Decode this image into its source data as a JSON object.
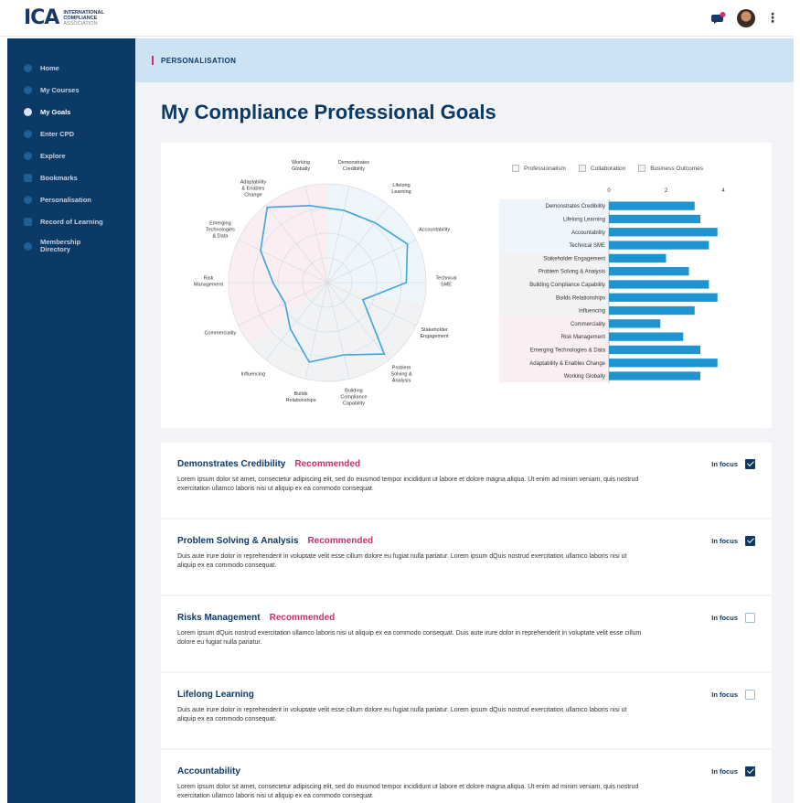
{
  "brand": {
    "mark": "ICA",
    "line1": "INTERNATIONAL",
    "line2": "COMPLIANCE",
    "line3": "ASSOCIATION"
  },
  "sidebar": {
    "items": [
      {
        "label": "Home",
        "icon": "home-icon"
      },
      {
        "label": "My Courses",
        "icon": "courses-icon"
      },
      {
        "label": "My Goals",
        "icon": "goals-icon",
        "active": true
      },
      {
        "label": "Enter CPD",
        "icon": "cpd-icon"
      },
      {
        "label": "Explore",
        "icon": "explore-icon"
      },
      {
        "label": "Bookmarks",
        "icon": "bookmark-icon"
      },
      {
        "label": "Personalisation",
        "icon": "personalisation-icon"
      },
      {
        "label": "Record of Learning",
        "icon": "record-icon"
      },
      {
        "label": "Membership Directory",
        "icon": "directory-icon"
      }
    ]
  },
  "breadcrumb": "PERSONALISATION",
  "page_title": "My Compliance Professional Goals",
  "chart_data": [
    {
      "type": "radar",
      "axes": [
        "Demonstrates Credibility",
        "Lifelong Learning",
        "Accountability",
        "Technical SME",
        "Stakeholder Engagement",
        "Problem Solving & Analysis",
        "Building Compliance Capability",
        "Builds Relationships",
        "Influencing",
        "Commerciality",
        "Risk Management",
        "Emerging Technologies & Data",
        "Adaptability & Enables Change",
        "Working Globally"
      ],
      "values": [
        3,
        3.1,
        3.6,
        3.2,
        1.6,
        3.7,
        3.0,
        3.3,
        2.4,
        1.9,
        2.2,
        3.0,
        3.9,
        3.2
      ],
      "rmax": 4
    },
    {
      "type": "bar",
      "orientation": "horizontal",
      "categories": [
        "Demonstrates Credibility",
        "Lifelong Learning",
        "Accountability",
        "Technical SME",
        "Stakeholder Engagement",
        "Problem Solving & Analysis",
        "Building Compliance Capability",
        "Builds Relationships",
        "Influencing",
        "Commerciality",
        "Risk Management",
        "Emerging Technologies & Data",
        "Adaptability & Enables Change",
        "Working Globally"
      ],
      "values": [
        3.0,
        3.2,
        3.8,
        3.5,
        2.0,
        2.8,
        3.5,
        3.8,
        3.0,
        1.8,
        2.6,
        3.2,
        3.8,
        3.2
      ],
      "groups": [
        "Professionalism",
        "Professionalism",
        "Professionalism",
        "Professionalism",
        "Collaboration",
        "Collaboration",
        "Collaboration",
        "Collaboration",
        "Collaboration",
        "Business Outcomes",
        "Business Outcomes",
        "Business Outcomes",
        "Business Outcomes",
        "Business Outcomes"
      ],
      "xlim": [
        0,
        4
      ],
      "xticks": [
        "0",
        "2",
        "4"
      ]
    }
  ],
  "legend": [
    {
      "label": "Professionalism",
      "color": "#eef5fb"
    },
    {
      "label": "Collaboration",
      "color": "#f1f2f4"
    },
    {
      "label": "Business Outcomes",
      "color": "#fbeef3"
    }
  ],
  "bar_color": "#1e95d0",
  "radar_line_color": "#3aa6dd",
  "accent": "#c8306e",
  "focus_label": "In focus",
  "goals": [
    {
      "title": "Demonstrates Credibility",
      "recommended": "Recommended",
      "desc": "Lorem ipsum dolor sit amet, consectetur adipiscing elit, sed do eiusmod tempor incididunt ut labore et dolore magna aliqua. Ut enim ad minim veniam, quis nostrud exercitation ullamco laboris nisi ut aliquip ex ea commodo consequat.",
      "in_focus": true
    },
    {
      "title": "Problem Solving & Analysis",
      "recommended": "Recommended",
      "desc": "Duis aute irure dolor in reprehenderit in voluptate velit esse cillum dolore eu fugiat nulla pariatur. Lorem ipsum dQuis nostrud exercitation ullamco laboris nisi ut aliquip ex ea commodo consequat.",
      "in_focus": true
    },
    {
      "title": "Risks Management",
      "recommended": "Recommended",
      "desc": "Lorem ipsum dQuis nostrud exercitation ullamco laboris nisi ut aliquip ex ea commodo consequat. Duis aute irure dolor in reprehenderit in voluptate velit esse cillum dolore eu fugiat nulla pariatur.",
      "in_focus": false
    },
    {
      "title": "Lifelong Learning",
      "recommended": "",
      "desc": "Duis aute irure dolor in reprehenderit in voluptate velit esse cillum dolore eu fugiat nulla pariatur. Lorem ipsum dQuis nostrud exercitation ullamco laboris nisi ut aliquip ex ea commodo consequat.",
      "in_focus": false
    },
    {
      "title": "Accountability",
      "recommended": "",
      "desc": "Lorem ipsum dolor sit amet, consectetur adipiscing elit, sed do eiusmod tempor incididunt ut labore et dolore magna aliqua. Ut enim ad minim veniam, quis nostrud exercitation ullamco laboris nisi ut aliquip ex ea commodo consequat.",
      "in_focus": true
    }
  ]
}
